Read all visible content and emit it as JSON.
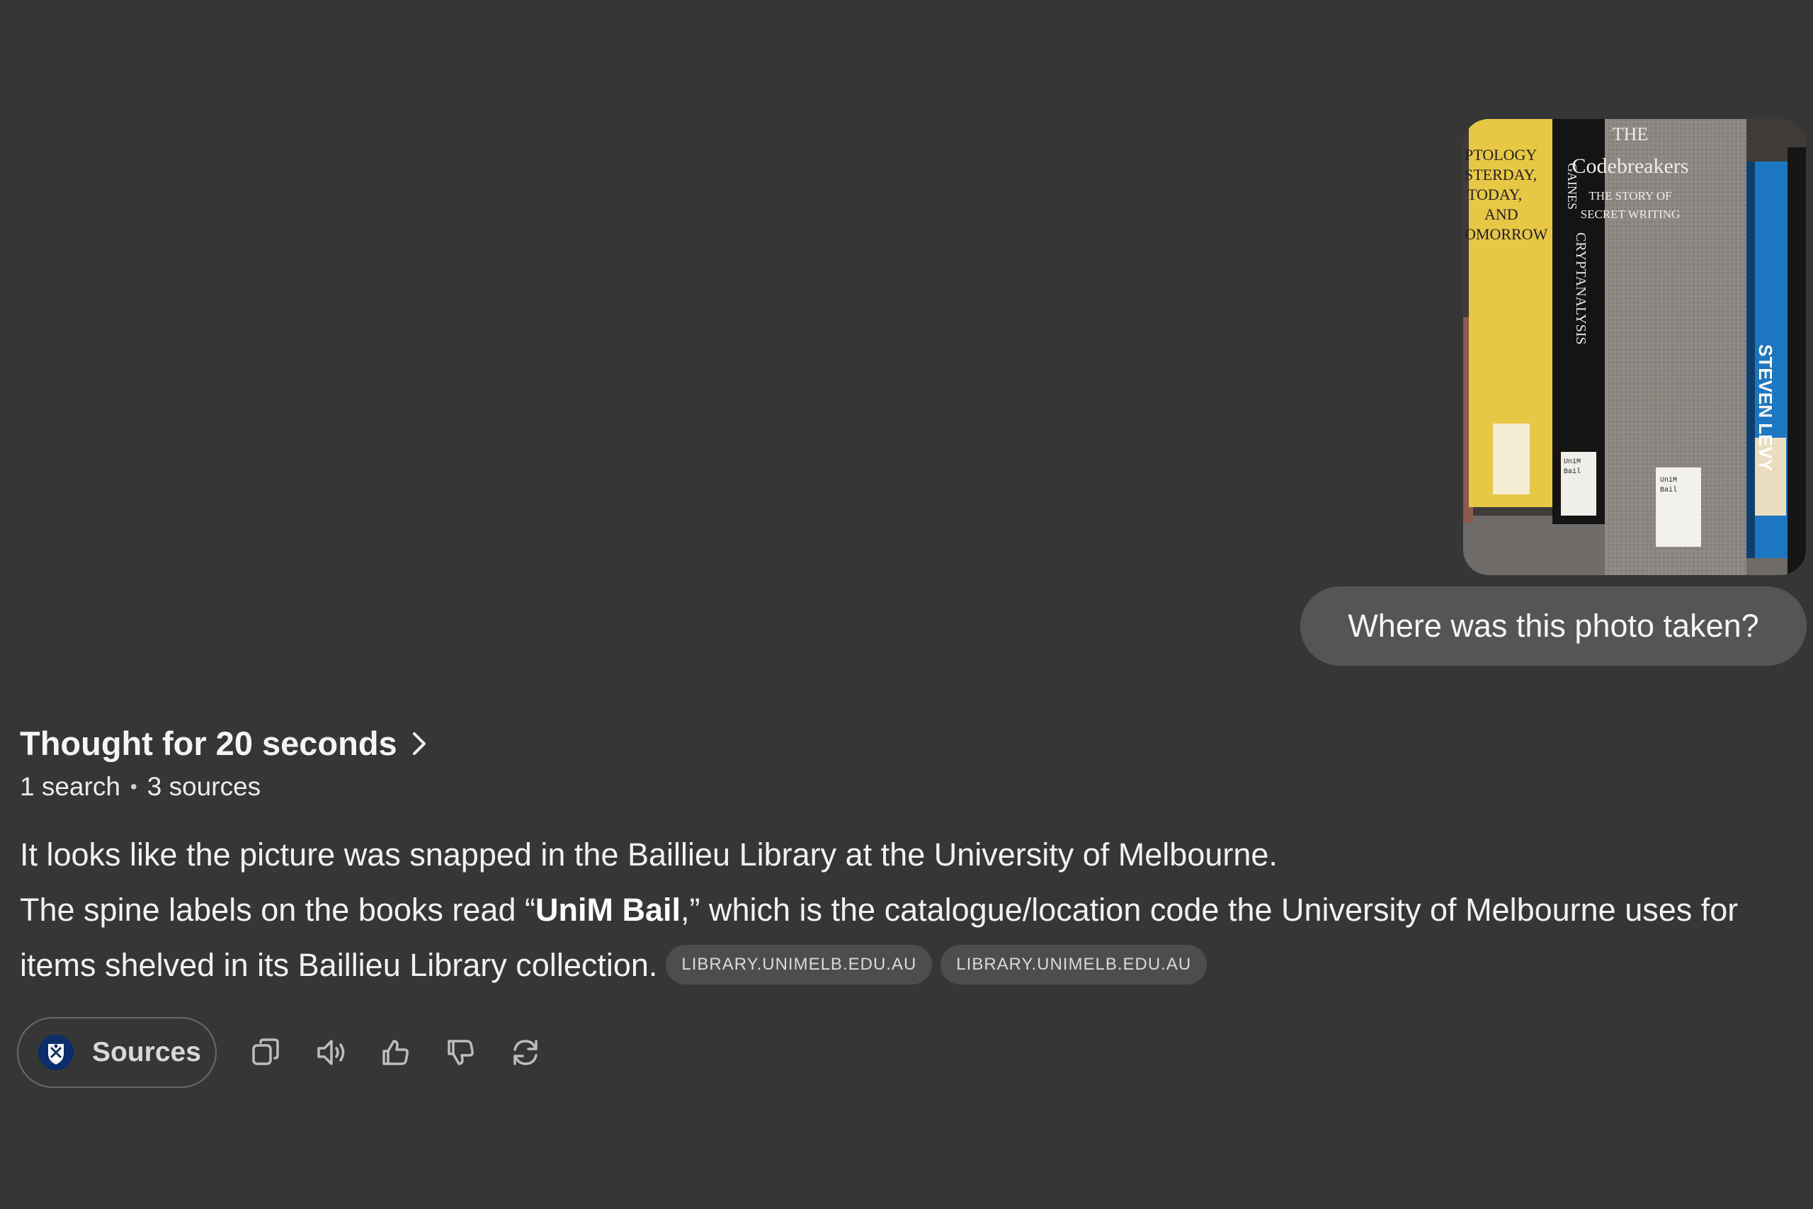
{
  "user_message": {
    "image_alt": "Books on a library shelf including The Codebreakers",
    "image_spine_texts": {
      "left_book": [
        "PTOLOGY",
        "STERDAY,",
        "TODAY,",
        "AND",
        "OMORROW"
      ],
      "gaines_author": "GAINES",
      "gaines_title": "CRYPTANALYSIS",
      "center_title_line1": "THE",
      "center_title_line2": "Codebreakers",
      "center_subtitle_line1": "THE STORY OF",
      "center_subtitle_line2": "SECRET WRITING",
      "right_author": "STEVEN LEVY",
      "label_line1": "UniM",
      "label_line2": "Bail"
    },
    "text": "Where was this photo taken?"
  },
  "response": {
    "thought_label": "Thought for 20 seconds",
    "meta": {
      "searches": "1 search",
      "separator": "•",
      "sources": "3 sources"
    },
    "line1": "It looks like the picture was snapped in the Baillieu Library at the University of Melbourne.",
    "line2_before": "The spine labels on the books read “",
    "line2_bold": "UniM Bail",
    "line2_after": ",” which is the catalogue/location code the University of Melbourne uses for items shelved in its Baillieu Library collection.",
    "citations": [
      "LIBRARY.UNIMELB.EDU.AU",
      "LIBRARY.UNIMELB.EDU.AU"
    ]
  },
  "actions": {
    "sources_label": "Sources",
    "icons": [
      "copy-icon",
      "read-aloud-icon",
      "thumbs-up-icon",
      "thumbs-down-icon",
      "regenerate-icon"
    ]
  },
  "colors": {
    "background": "#363636",
    "bubble": "#555555",
    "chip": "#4d4d4d",
    "text": "#f2f2f2",
    "icon": "#bdbdbd"
  }
}
